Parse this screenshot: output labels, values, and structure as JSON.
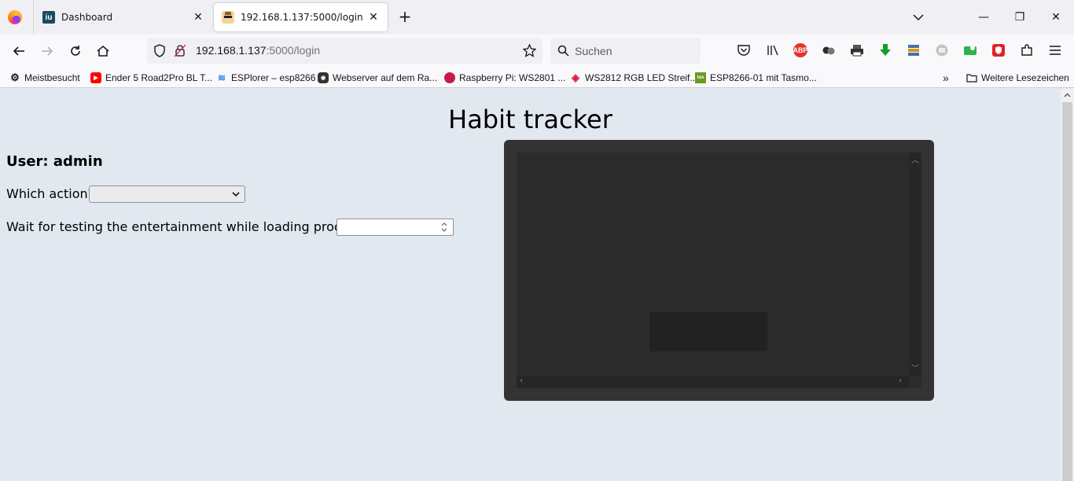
{
  "browser": {
    "tabs": [
      {
        "title": "Dashboard",
        "favicon": "iu-logo-icon",
        "active": false
      },
      {
        "title": "192.168.1.137:5000/login",
        "favicon": "spy-cat-icon",
        "active": true
      }
    ],
    "url_host": "192.168.1.137",
    "url_rest": ":5000/login",
    "search_placeholder": "Suchen",
    "bookmarks": [
      {
        "label": "Meistbesucht",
        "icon": "gear-icon"
      },
      {
        "label": "Ender 5 Road2Pro BL T...",
        "icon": "youtube-icon"
      },
      {
        "label": "ESPlorer – esp8266",
        "icon": "wifi-icon"
      },
      {
        "label": "Webserver auf dem Ra...",
        "icon": "robot-icon"
      },
      {
        "label": "Raspberry Pi: WS2801 ...",
        "icon": "raspberry-icon"
      },
      {
        "label": "WS2812 RGB LED Streif...",
        "icon": "drop-icon"
      },
      {
        "label": "ESP8266-01 mit Tasmo...",
        "icon": "loxwiki-icon"
      }
    ],
    "more_bookmarks_label": "Weitere Lesezeichen"
  },
  "page": {
    "title": "Habit tracker",
    "user_line": "User: admin",
    "action_label": "Which action?",
    "action_selected": "",
    "wait_label": "Wait for testing the entertainment while loading process?",
    "wait_value": ""
  },
  "colors": {
    "page_background": "#e2e8f0",
    "monitor_frame": "#333333",
    "monitor_screen": "#2b2b2b"
  }
}
